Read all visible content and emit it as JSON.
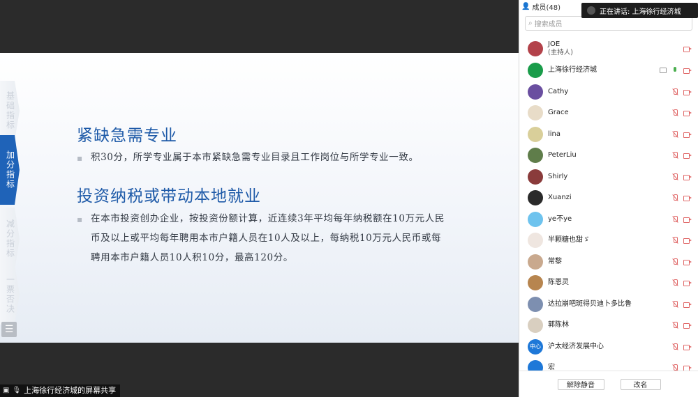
{
  "slide": {
    "tabs": [
      "基础指标",
      "加分指标",
      "减分指标",
      "一票否决"
    ],
    "active_tab": 1,
    "menu_icon": "list-icon",
    "sections": [
      {
        "heading": "紧缺急需专业",
        "text": "积30分，所学专业属于本市紧缺急需专业目录且工作岗位与所学专业一致。"
      },
      {
        "heading": "投资纳税或带动本地就业",
        "text": "在本市投资创办企业，按投资份额计算，近连续3年平均每年纳税额在10万元人民币及以上或平均每年聘用本市户籍人员在10人及以上，每纳税10万元人民币或每聘用本市户籍人员10人积10分，最高120分。"
      }
    ]
  },
  "share_bar": {
    "label": "上海徐行经济城的屏幕共享"
  },
  "speaking": {
    "label": "正在讲话: 上海徐行经济城"
  },
  "panel": {
    "header": "成员(48)",
    "search_placeholder": "搜索成员",
    "members": [
      {
        "name": "JOE",
        "sub": "(主持人)",
        "avatar_color": "#b3424a",
        "mic": "none",
        "cam": "off"
      },
      {
        "name": "上海徐行经济城",
        "avatar_color": "#1a9c4a",
        "mic": "on",
        "cam": "off",
        "screen": true
      },
      {
        "name": "Cathy",
        "avatar_color": "#6a4fa0",
        "mic": "off",
        "cam": "off"
      },
      {
        "name": "Grace",
        "avatar_color": "#e8dcc8",
        "mic": "off",
        "cam": "off"
      },
      {
        "name": "lina",
        "avatar_color": "#d9cf9a",
        "mic": "off",
        "cam": "off"
      },
      {
        "name": "PeterLiu",
        "avatar_color": "#5f7d4a",
        "mic": "off",
        "cam": "off"
      },
      {
        "name": "Shirly",
        "avatar_color": "#8a3b3b",
        "mic": "off",
        "cam": "off"
      },
      {
        "name": "Xuanzi",
        "avatar_color": "#2a2a2a",
        "mic": "off",
        "cam": "off"
      },
      {
        "name": "ye不ye",
        "avatar_color": "#6ec3ee",
        "mic": "off",
        "cam": "off"
      },
      {
        "name": "半颗糖也甜ゞ",
        "avatar_color": "#efe6e0",
        "mic": "off",
        "cam": "off"
      },
      {
        "name": "常黎",
        "avatar_color": "#c9a98e",
        "mic": "off",
        "cam": "off"
      },
      {
        "name": "陈恩灵",
        "avatar_color": "#b7854f",
        "mic": "off",
        "cam": "off"
      },
      {
        "name": "达拉崩吧斑得贝迪卜多比鲁",
        "avatar_color": "#7d8fb0",
        "mic": "off",
        "cam": "off"
      },
      {
        "name": "郭陈林",
        "avatar_color": "#d9cfc0",
        "mic": "off",
        "cam": "off"
      },
      {
        "name": "沪太经济发展中心",
        "avatar_text": "中心",
        "avatar_color": "#1e78d8",
        "mic": "off",
        "cam": "off"
      },
      {
        "name": "宏",
        "avatar_color": "#1e78d8",
        "mic": "off",
        "cam": "off"
      }
    ],
    "footer": {
      "unmute_label": "解除静音",
      "rename_label": "改名"
    }
  },
  "colors": {
    "accent": "#1f63b8",
    "heading": "#1e5aa8",
    "mute_red": "#e06868",
    "mic_green": "#4caf50"
  }
}
